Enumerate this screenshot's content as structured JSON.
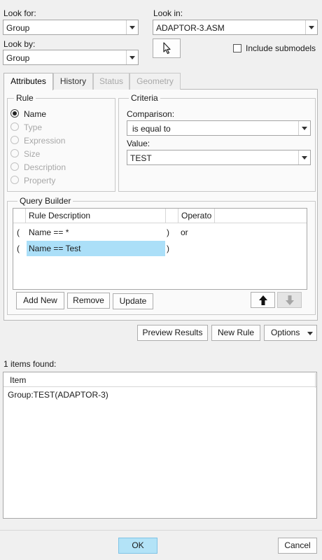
{
  "look_for": {
    "label": "Look for:",
    "value": "Group"
  },
  "look_by": {
    "label": "Look by:",
    "value": "Group"
  },
  "look_in": {
    "label": "Look in:",
    "value": "ADAPTOR-3.ASM"
  },
  "include_submodels": {
    "label": "Include submodels",
    "checked": false
  },
  "tabs": [
    {
      "label": "Attributes",
      "active": true,
      "disabled": false
    },
    {
      "label": "History",
      "active": false,
      "disabled": false
    },
    {
      "label": "Status",
      "active": false,
      "disabled": true
    },
    {
      "label": "Geometry",
      "active": false,
      "disabled": true
    }
  ],
  "rule": {
    "title": "Rule",
    "options": [
      {
        "label": "Name",
        "checked": true,
        "disabled": false
      },
      {
        "label": "Type",
        "checked": false,
        "disabled": true
      },
      {
        "label": "Expression",
        "checked": false,
        "disabled": true
      },
      {
        "label": "Size",
        "checked": false,
        "disabled": true
      },
      {
        "label": "Description",
        "checked": false,
        "disabled": true
      },
      {
        "label": "Property",
        "checked": false,
        "disabled": true
      }
    ]
  },
  "criteria": {
    "title": "Criteria",
    "comparison_label": "Comparison:",
    "comparison_value": "is equal to",
    "value_label": "Value:",
    "value_value": "TEST"
  },
  "query_builder": {
    "title": "Query Builder",
    "columns": [
      "Rule Description",
      "Operato"
    ],
    "rows": [
      {
        "open": "(",
        "description": "Name  ==  *",
        "close": ")",
        "operator": "or",
        "selected": false
      },
      {
        "open": "(",
        "description": "Name  ==  Test",
        "close": ")",
        "operator": "",
        "selected": true
      }
    ],
    "add_new_label": "Add New",
    "remove_label": "Remove",
    "update_label": "Update"
  },
  "actions": {
    "preview_label": "Preview Results",
    "new_rule_label": "New Rule",
    "options_label": "Options"
  },
  "results": {
    "count_text": "1 items found:",
    "column": "Item",
    "items": [
      "Group:TEST(ADAPTOR-3)"
    ]
  },
  "footer": {
    "ok_label": "OK",
    "cancel_label": "Cancel"
  },
  "colors": {
    "selection": "#abdff8",
    "ok_button": "#b3e3f7"
  }
}
